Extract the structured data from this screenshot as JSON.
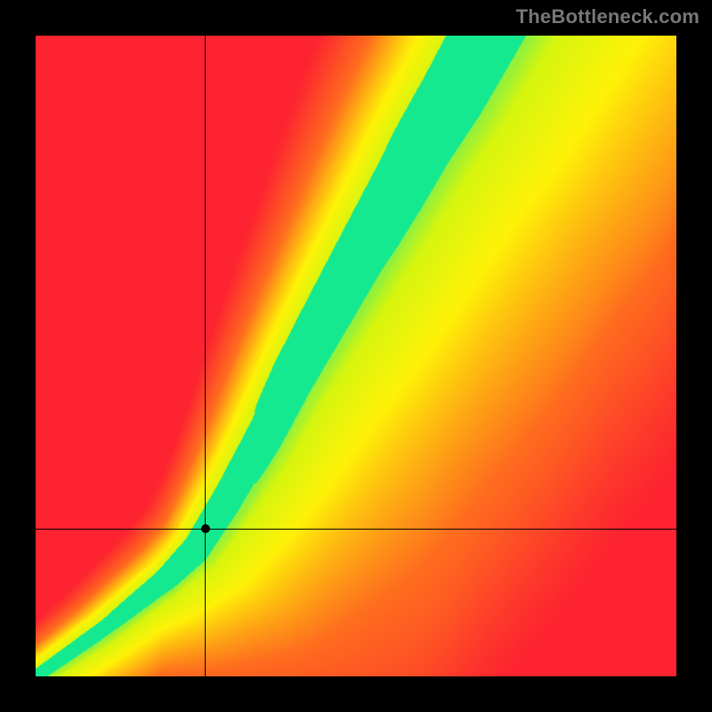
{
  "watermark": "TheBottleneck.com",
  "colors": {
    "page_bg": "#000000",
    "text": "#777777"
  },
  "chart_data": {
    "type": "heatmap",
    "title": "",
    "xlabel": "",
    "ylabel": "",
    "x_range": [
      0,
      1
    ],
    "y_range": [
      0,
      1
    ],
    "ridge": {
      "description": "Optimal-match ridge (green band) as y = f(x); values are fractions of plot width/height (origin at bottom-left).",
      "points": [
        {
          "x": 0.0,
          "y": 0.0
        },
        {
          "x": 0.1,
          "y": 0.07
        },
        {
          "x": 0.2,
          "y": 0.15
        },
        {
          "x": 0.25,
          "y": 0.2
        },
        {
          "x": 0.3,
          "y": 0.28
        },
        {
          "x": 0.35,
          "y": 0.37
        },
        {
          "x": 0.4,
          "y": 0.47
        },
        {
          "x": 0.45,
          "y": 0.56
        },
        {
          "x": 0.5,
          "y": 0.65
        },
        {
          "x": 0.55,
          "y": 0.74
        },
        {
          "x": 0.6,
          "y": 0.83
        },
        {
          "x": 0.65,
          "y": 0.91
        },
        {
          "x": 0.7,
          "y": 1.0
        }
      ],
      "half_width": {
        "description": "Approximate half-width of the green band perpendicular to the ridge, as a fraction of plot size, varying with x.",
        "samples": [
          {
            "x": 0.0,
            "w": 0.012
          },
          {
            "x": 0.2,
            "w": 0.018
          },
          {
            "x": 0.4,
            "w": 0.035
          },
          {
            "x": 0.6,
            "w": 0.05
          },
          {
            "x": 0.8,
            "w": 0.06
          },
          {
            "x": 1.0,
            "w": 0.068
          }
        ]
      }
    },
    "marker": {
      "description": "Crosshair intersection point (black dot).",
      "x": 0.265,
      "y": 0.23,
      "radius_px": 5
    },
    "color_scale": {
      "description": "Value 0 = far from ridge, 1 = on ridge. Gradient red→orange→yellow→green.",
      "stops": [
        {
          "v": 0.0,
          "color": "#fd2330"
        },
        {
          "v": 0.35,
          "color": "#fe6d1e"
        },
        {
          "v": 0.65,
          "color": "#fef207"
        },
        {
          "v": 0.82,
          "color": "#d6f50e"
        },
        {
          "v": 1.0,
          "color": "#15e990"
        }
      ]
    },
    "asymmetry": {
      "description": "Cells above the ridge (GPU-bound side, upper-left) fall off to red faster; cells below (lower-right) linger yellow/orange longer.",
      "above_falloff": 1.0,
      "below_falloff": 0.55
    }
  }
}
